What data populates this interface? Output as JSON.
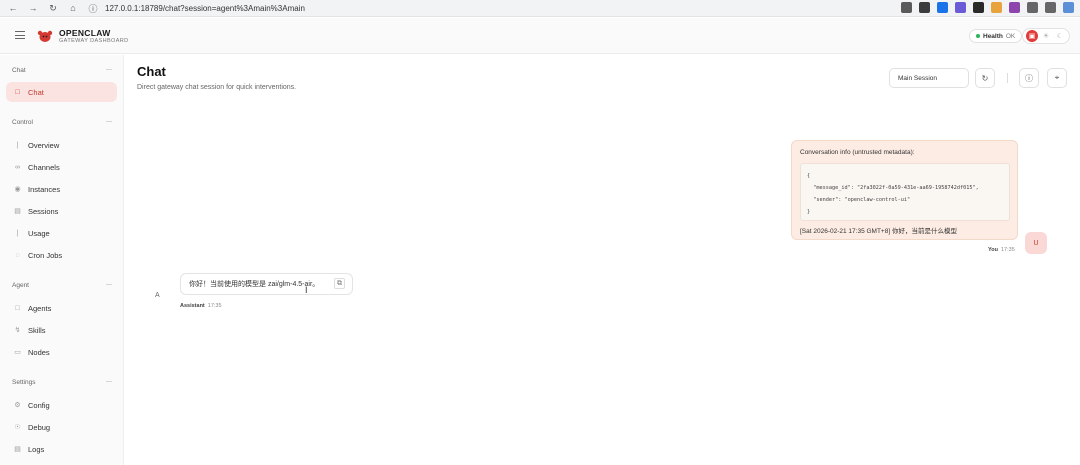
{
  "browser": {
    "url": "127.0.0.1:18789/chat?session=agent%3Amain%3Amain",
    "icons": [
      "back-icon",
      "forward-icon",
      "reload-icon",
      "home-icon",
      "info-icon"
    ],
    "ext_colors": [
      "#5a5a5a",
      "#3c3c3c",
      "#1a73e8",
      "#6b5bd6",
      "#2a2a2a",
      "#e8a33c",
      "#8e44ad",
      "#666666",
      "#666666",
      "#5b8fd6"
    ]
  },
  "header": {
    "brand": "OPENCLAW",
    "brand_sub": "GATEWAY DASHBOARD",
    "health_label": "Health",
    "health_status": "OK",
    "accent": "#e03a3a"
  },
  "sidebar": {
    "sections": [
      {
        "title": "Chat",
        "items": [
          {
            "label": "Chat",
            "icon": "chat-icon",
            "active": true
          }
        ]
      },
      {
        "title": "Control",
        "items": [
          {
            "label": "Overview",
            "icon": "bar-chart-icon"
          },
          {
            "label": "Channels",
            "icon": "link-icon"
          },
          {
            "label": "Instances",
            "icon": "broadcast-icon"
          },
          {
            "label": "Sessions",
            "icon": "document-icon"
          },
          {
            "label": "Usage",
            "icon": "bar-chart-icon"
          },
          {
            "label": "Cron Jobs",
            "icon": "clock-icon"
          }
        ]
      },
      {
        "title": "Agent",
        "items": [
          {
            "label": "Agents",
            "icon": "folder-icon"
          },
          {
            "label": "Skills",
            "icon": "bolt-icon"
          },
          {
            "label": "Nodes",
            "icon": "monitor-icon"
          }
        ]
      },
      {
        "title": "Settings",
        "items": [
          {
            "label": "Config",
            "icon": "gear-icon"
          },
          {
            "label": "Debug",
            "icon": "bug-icon"
          },
          {
            "label": "Logs",
            "icon": "logs-icon"
          }
        ]
      }
    ]
  },
  "main": {
    "title": "Chat",
    "subtitle": "Direct gateway chat session for quick interventions.",
    "session_select": "Main Session"
  },
  "messages": {
    "user": {
      "header": "Conversation info (untrusted metadata):",
      "code": "{\n  \"message_id\": \"2fa3022f-0a59-431e-aa69-1958742df015\",\n  \"sender\": \"openclaw-control-ui\"\n}",
      "footer": "[Sat 2026-02-21 17:35 GMT+8] 你好，当前是什么模型",
      "sender_label": "You",
      "time": "17:35",
      "avatar": "U"
    },
    "assistant": {
      "text": "你好！当前使用的模型是 zai/glm-4.5-air。",
      "sender_label": "Assistant",
      "time": "17:35",
      "avatar": "A"
    }
  }
}
